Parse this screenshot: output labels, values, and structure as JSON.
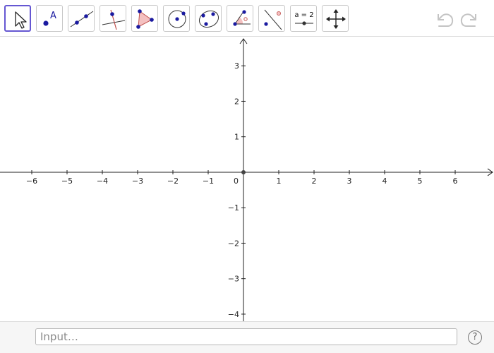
{
  "toolbar": {
    "tools": [
      {
        "name": "move-tool"
      },
      {
        "name": "point-tool",
        "glyph": "A"
      },
      {
        "name": "line-tool"
      },
      {
        "name": "perpendicular-line-tool"
      },
      {
        "name": "polygon-tool"
      },
      {
        "name": "circle-with-center-tool"
      },
      {
        "name": "conic-through-five-points-tool"
      },
      {
        "name": "angle-tool"
      },
      {
        "name": "reflect-about-line-tool"
      },
      {
        "name": "slider-tool",
        "glyph": "a = 2"
      },
      {
        "name": "move-graphics-view-tool"
      }
    ],
    "selected_tool": "move-tool",
    "undo_icon": "undo-icon",
    "redo_icon": "redo-icon"
  },
  "graphics": {
    "x_ticks": [
      "−6",
      "−5",
      "−4",
      "−3",
      "−2",
      "−1",
      "1",
      "2",
      "3",
      "4",
      "5",
      "6"
    ],
    "y_ticks": [
      "3",
      "2",
      "1",
      "−1",
      "−2",
      "−3",
      "−4"
    ],
    "origin_label": "0",
    "x_range": [
      -6.9,
      7.1
    ],
    "y_range": [
      -4.2,
      3.8
    ]
  },
  "input_bar": {
    "placeholder": "Input…",
    "help_label": "?"
  },
  "colors": {
    "accent": "#6557d2",
    "point": "#1a1aa0",
    "polygon_fill": "#f4c0c0",
    "polygon_edge": "#c0504d",
    "axis": "#222222"
  }
}
